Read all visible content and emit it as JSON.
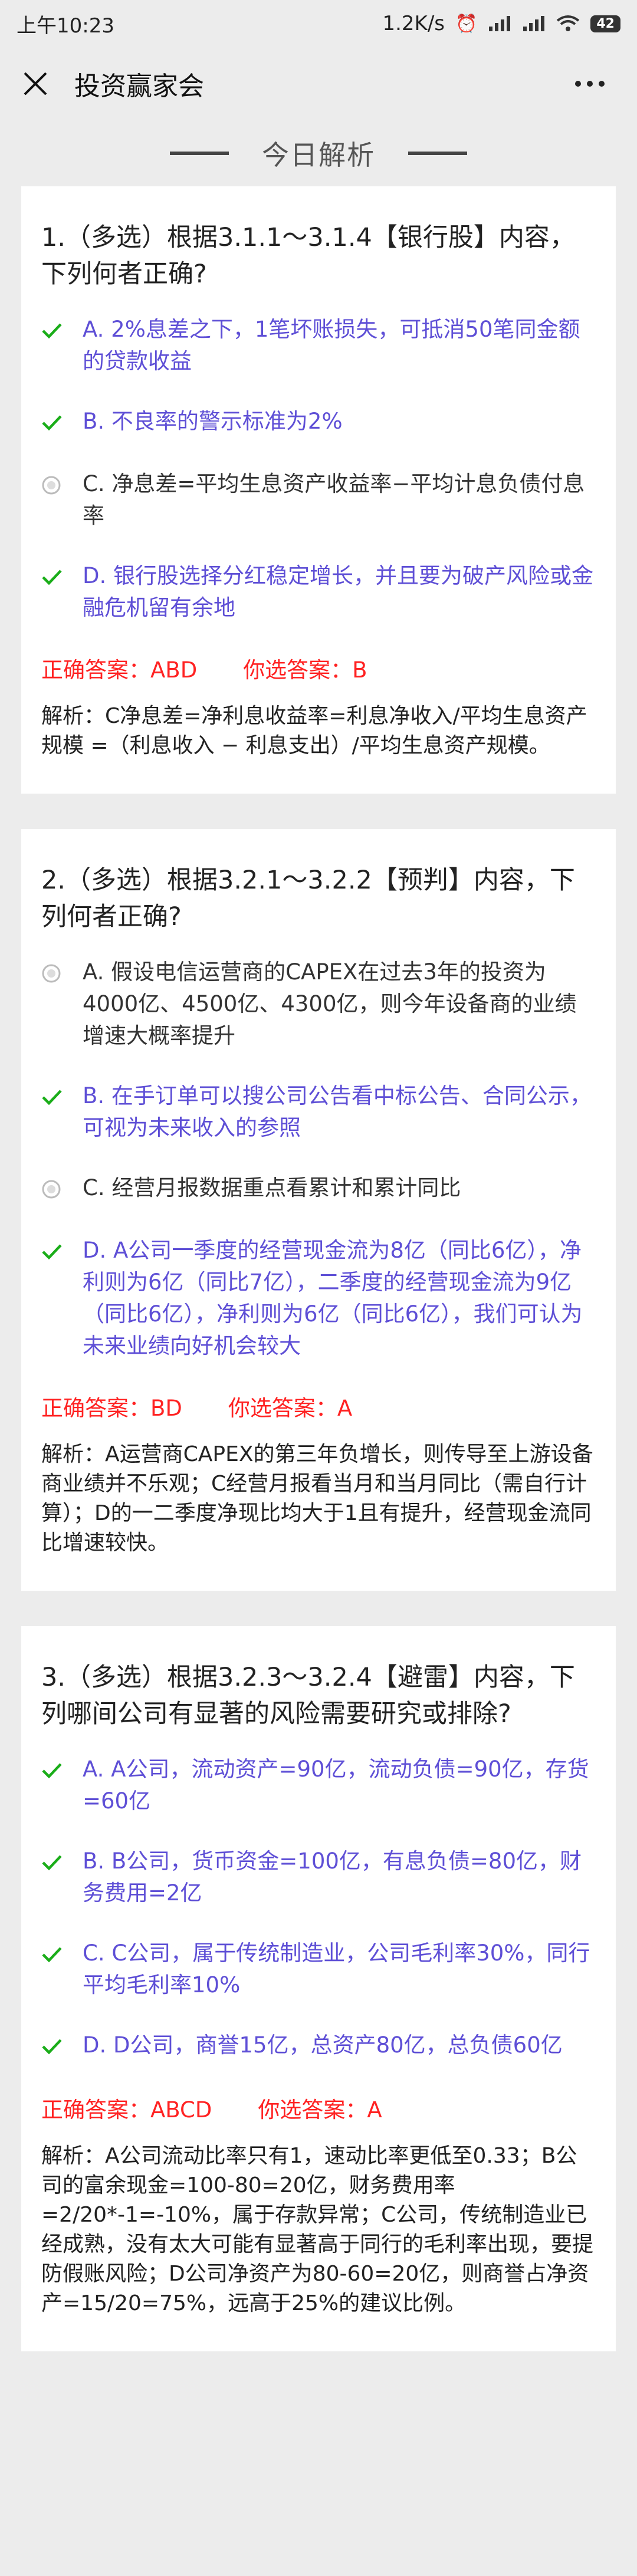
{
  "status": {
    "time": "上午10:23",
    "net_speed": "1.2K/s",
    "battery": "42"
  },
  "nav": {
    "title": "投资赢家会"
  },
  "section": {
    "title": "今日解析"
  },
  "questions": [
    {
      "stem": "1.（多选）根据3.1.1～3.1.4【银行股】内容，下列何者正确?",
      "options": [
        {
          "text": "A. 2%息差之下，1笔坏账损失，可抵消50笔同金额的贷款收益",
          "state": "correct"
        },
        {
          "text": "B. 不良率的警示标准为2%",
          "state": "correct"
        },
        {
          "text": "C. 净息差=平均生息资产收益率−平均计息负债付息率",
          "state": "normal"
        },
        {
          "text": "D. 银行股选择分红稳定增长，并且要为破产风险或金融危机留有余地",
          "state": "correct"
        }
      ],
      "correct_label": "正确答案：ABD",
      "chosen_label": "你选答案：B",
      "analysis": "解析：C净息差=净利息收益率=利息净收入/平均生息资产规模 =（利息收入 − 利息支出）/平均生息资产规模。"
    },
    {
      "stem": "2.（多选）根据3.2.1～3.2.2【预判】内容，下列何者正确?",
      "options": [
        {
          "text": "A. 假设电信运营商的CAPEX在过去3年的投资为4000亿、4500亿、4300亿，则今年设备商的业绩增速大概率提升",
          "state": "normal"
        },
        {
          "text": "B. 在手订单可以搜公司公告看中标公告、合同公示，可视为未来收入的参照",
          "state": "correct"
        },
        {
          "text": "C. 经营月报数据重点看累计和累计同比",
          "state": "normal"
        },
        {
          "text": "D. A公司一季度的经营现金流为8亿（同比6亿），净利则为6亿（同比7亿），二季度的经营现金流为9亿（同比6亿），净利则为6亿（同比6亿），我们可认为未来业绩向好机会较大",
          "state": "correct"
        }
      ],
      "correct_label": "正确答案：BD",
      "chosen_label": "你选答案：A",
      "analysis": "解析：A运营商CAPEX的第三年负增长，则传导至上游设备商业绩并不乐观；C经营月报看当月和当月同比（需自行计算）；D的一二季度净现比均大于1且有提升，经营现金流同比增速较快。"
    },
    {
      "stem": "3.（多选）根据3.2.3～3.2.4【避雷】内容，下列哪间公司有显著的风险需要研究或排除?",
      "options": [
        {
          "text": "A. A公司，流动资产=90亿，流动负债=90亿，存货=60亿",
          "state": "correct"
        },
        {
          "text": "B. B公司，货币资金=100亿，有息负债=80亿，财务费用=2亿",
          "state": "correct"
        },
        {
          "text": "C. C公司，属于传统制造业，公司毛利率30%，同行平均毛利率10%",
          "state": "correct"
        },
        {
          "text": "D. D公司，商誉15亿，总资产80亿，总负债60亿",
          "state": "correct"
        }
      ],
      "correct_label": "正确答案：ABCD",
      "chosen_label": "你选答案：A",
      "analysis": "解析：A公司流动比率只有1，速动比率更低至0.33；B公司的富余现金=100-80=20亿，财务费用率=2/20*-1=-10%，属于存款异常；C公司，传统制造业已经成熟，没有太大可能有显著高于同行的毛利率出现，要提防假账风险；D公司净资产为80-60=20亿，则商誉占净资产=15/20=75%，远高于25%的建议比例。"
    }
  ],
  "colors": {
    "correct_option": "#5e4fd6",
    "check_mark": "#1aad19",
    "answer_red": "#ff2222"
  },
  "icons": {
    "correct": "check-icon",
    "normal": "radio-icon",
    "close": "close-icon",
    "more": "more-icon"
  }
}
